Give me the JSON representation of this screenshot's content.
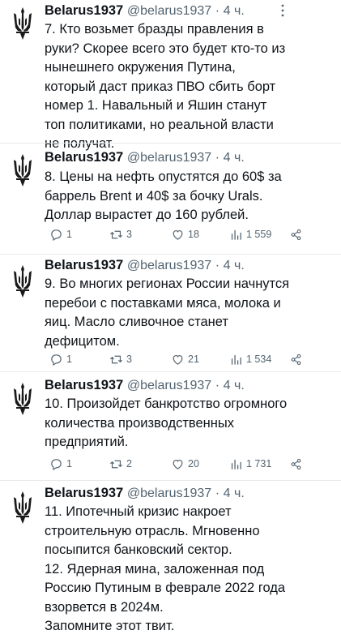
{
  "tweets": [
    {
      "name": "Belarus1937",
      "handle": "@belarus1937",
      "dot": "·",
      "time": "4 ч.",
      "text": "7. Кто возьмет бразды правления в руки? Скорее всего это будет кто-то из нынешнего окружения Путина, который даст приказ ПВО сбить борт номер 1. Навальный и Яшин станут топ политиками, но реальной власти не получат."
    },
    {
      "name": "Belarus1937",
      "handle": "@belarus1937",
      "dot": "·",
      "time": "4 ч.",
      "text": "8. Цены на нефть опустятся до 60$ за баррель Brent и 40$ за бочку Urals. Доллар вырастет до 160 рублей.",
      "replies": "1",
      "retweets": "3",
      "likes": "18",
      "views": "1 559"
    },
    {
      "name": "Belarus1937",
      "handle": "@belarus1937",
      "dot": "·",
      "time": "4 ч.",
      "text": "9. Во многих регионах России начнутся перебои с поставками мяса, молока и яиц. Масло сливочное станет дефицитом.",
      "replies": "1",
      "retweets": "3",
      "likes": "21",
      "views": "1 534"
    },
    {
      "name": "Belarus1937",
      "handle": "@belarus1937",
      "dot": "·",
      "time": "4 ч.",
      "text": "10. Произойдет банкротство огромного количества производственных предприятий.",
      "replies": "1",
      "retweets": "2",
      "likes": "20",
      "views": "1 731"
    },
    {
      "name": "Belarus1937",
      "handle": "@belarus1937",
      "dot": "·",
      "time": "4 ч.",
      "text_lines": [
        "11. Ипотечный кризис накроет строительную отрасль. Мгновенно посыпится банковский сектор.",
        "12. Ядерная мина, заложенная под Россию Путиным в феврале 2022 года взорвется в 2024м.",
        "Запомните этот твит."
      ]
    }
  ],
  "icons": {
    "avatar": "trident-coat-of-arms-icon",
    "more": "more-dots-icon",
    "reply": "reply-icon",
    "retweet": "retweet-icon",
    "like": "heart-icon",
    "views": "views-chart-icon",
    "share": "share-icon"
  },
  "colors": {
    "text": "#0f1419",
    "secondary": "#536471",
    "divider": "#e6e9eb"
  }
}
